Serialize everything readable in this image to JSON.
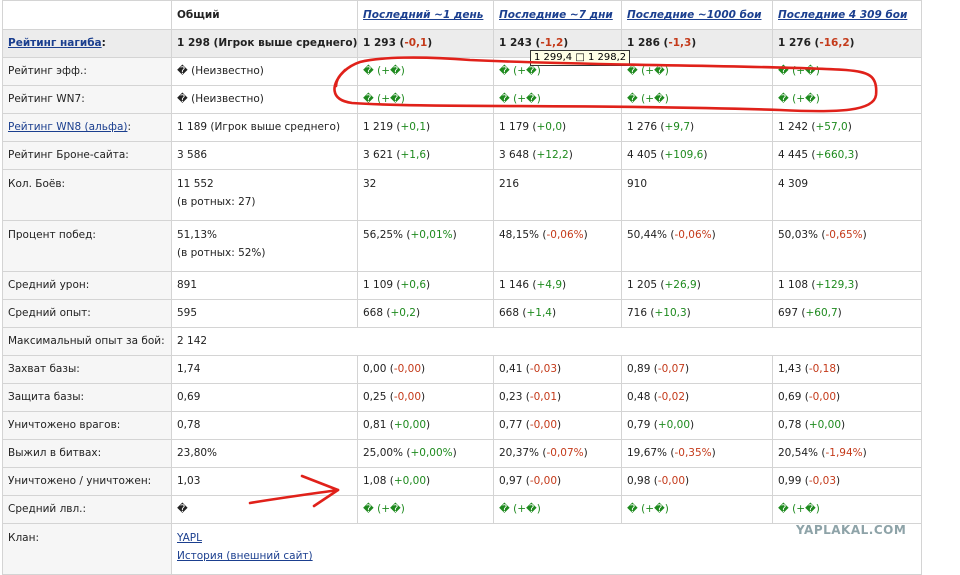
{
  "header": {
    "general": "Общий",
    "day": "Последний ~1 день",
    "week": "Последние ~7 дни",
    "thousand": "Последние ~1000 бои",
    "all": "Последние 4 309 бои"
  },
  "rows": {
    "nagib": {
      "label": "Рейтинг нагиба",
      "colon": ":",
      "gen": "1 298 (Игрок выше среднего)",
      "day": "1 293",
      "day_d": "-0,1",
      "week": "1 243",
      "week_d": "-1,2",
      "k": "1 286",
      "k_d": "-1,3",
      "all": "1 276",
      "all_d": "-16,2"
    },
    "eff": {
      "label": "Рейтинг эфф.:",
      "gen": "� (Неизвестно)",
      "day": "� (+�)",
      "week": "� (+�)",
      "k": "� (+�)",
      "all": "� (+�)"
    },
    "wn7": {
      "label": "Рейтинг WN7:",
      "gen": "� (Неизвестно)",
      "day": "� (+�)",
      "week": "� (+�)",
      "k": "� (+�)",
      "all": "� (+�)"
    },
    "wn8": {
      "label": "Рейтинг WN8 (альфа)",
      "colon": ":",
      "gen": "1 189 (Игрок выше среднего)",
      "day": "1 219",
      "day_d": "+0,1",
      "week": "1 179",
      "week_d": "+0,0",
      "k": "1 276",
      "k_d": "+9,7",
      "all": "1 242",
      "all_d": "+57,0"
    },
    "brone": {
      "label": "Рейтинг Броне-сайта:",
      "gen": "3 586",
      "day": "3 621",
      "day_d": "+1,6",
      "week": "3 648",
      "week_d": "+12,2",
      "k": "4 405",
      "k_d": "+109,6",
      "all": "4 445",
      "all_d": "+660,3"
    },
    "battles": {
      "label": "Кол. Боёв:",
      "gen": "11 552",
      "gen_sub": "(в ротных: 27)",
      "day": "32",
      "week": "216",
      "k": "910",
      "all": "4 309"
    },
    "winrate": {
      "label": "Процент побед:",
      "gen": "51,13%",
      "gen_sub": "(в ротных: 52%)",
      "day": "56,25%",
      "day_d": "+0,01%",
      "week": "48,15%",
      "week_d": "-0,06%",
      "k": "50,44%",
      "k_d": "-0,06%",
      "all": "50,03%",
      "all_d": "-0,65%"
    },
    "dmg": {
      "label": "Средний урон:",
      "gen": "891",
      "day": "1 109",
      "day_d": "+0,6",
      "week": "1 146",
      "week_d": "+4,9",
      "k": "1 205",
      "k_d": "+26,9",
      "all": "1 108",
      "all_d": "+129,3"
    },
    "xp": {
      "label": "Средний опыт:",
      "gen": "595",
      "day": "668",
      "day_d": "+0,2",
      "week": "668",
      "week_d": "+1,4",
      "k": "716",
      "k_d": "+10,3",
      "all": "697",
      "all_d": "+60,7"
    },
    "maxxp": {
      "label": "Максимальный опыт за бой:",
      "gen": "2 142"
    },
    "cap": {
      "label": "Захват базы:",
      "gen": "1,74",
      "day": "0,00",
      "day_d": "-0,00",
      "week": "0,41",
      "week_d": "-0,03",
      "k": "0,89",
      "k_d": "-0,07",
      "all": "1,43",
      "all_d": "-0,18"
    },
    "def": {
      "label": "Защита базы:",
      "gen": "0,69",
      "day": "0,25",
      "day_d": "-0,00",
      "week": "0,23",
      "week_d": "-0,01",
      "k": "0,48",
      "k_d": "-0,02",
      "all": "0,69",
      "all_d": "-0,00"
    },
    "frags": {
      "label": "Уничтожено врагов:",
      "gen": "0,78",
      "day": "0,81",
      "day_d": "+0,00",
      "week": "0,77",
      "week_d": "-0,00",
      "k": "0,79",
      "k_d": "+0,00",
      "all": "0,78",
      "all_d": "+0,00"
    },
    "surv": {
      "label": "Выжил в битвах:",
      "gen": "23,80%",
      "day": "25,00%",
      "day_d": "+0,00%",
      "week": "20,37%",
      "week_d": "-0,07%",
      "k": "19,67%",
      "k_d": "-0,35%",
      "all": "20,54%",
      "all_d": "-1,94%"
    },
    "kd": {
      "label": "Уничтожено / уничтожен:",
      "gen": "1,03",
      "day": "1,08",
      "day_d": "+0,00",
      "week": "0,97",
      "week_d": "-0,00",
      "k": "0,98",
      "k_d": "-0,00",
      "all": "0,99",
      "all_d": "-0,03"
    },
    "lvl": {
      "label": "Средний лвл.:",
      "gen": "�",
      "day": "� (+�)",
      "week": "� (+�)",
      "k": "� (+�)",
      "all": "� (+�)"
    },
    "clan": {
      "label": "Клан:",
      "clan_link": "YAPL",
      "history_link": "История (внешний сайт)"
    }
  },
  "tooltip": "1 299,4 □ 1 298,2",
  "watermark": "YAPLAKAL.COM",
  "colors": {
    "positive": "#1e8a1e",
    "negative": "#c43a1a",
    "link": "#1b3f8f",
    "annotation": "#e0211a"
  }
}
